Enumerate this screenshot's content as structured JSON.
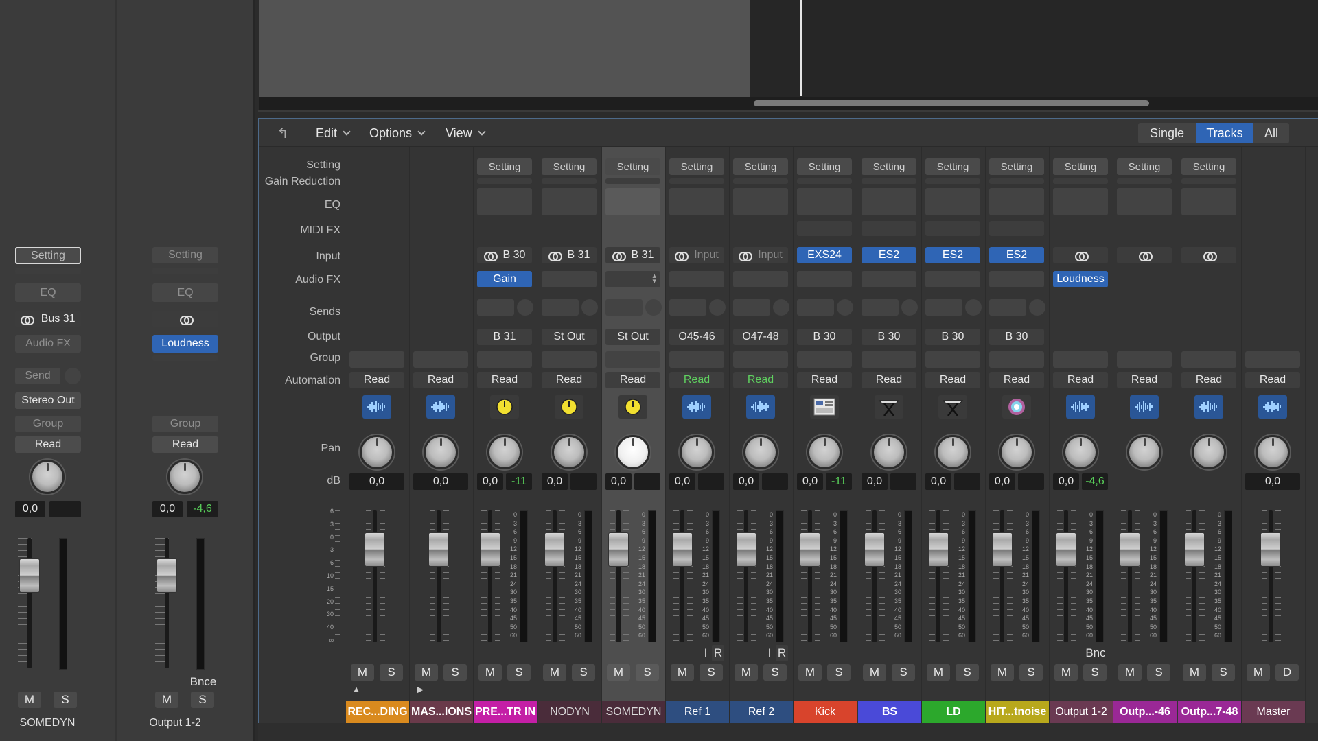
{
  "inspector": {
    "left": {
      "setting": "Setting",
      "eq": "EQ",
      "input_label": "Bus 31",
      "audio_fx": "Audio FX",
      "send": "Send",
      "output": "Stereo Out",
      "group": "Group",
      "automation": "Read",
      "volume": "0,0",
      "peak": "",
      "mute": "M",
      "solo": "S",
      "name": "SOMEDYN"
    },
    "right": {
      "setting": "Setting",
      "eq": "EQ",
      "audio_fx": "Loudness",
      "group": "Group",
      "automation": "Read",
      "volume": "0,0",
      "peak": "-4,6",
      "bounce": "Bnce",
      "mute": "M",
      "solo": "S",
      "name": "Output 1-2"
    }
  },
  "toolbar": {
    "back_icon": "back-arrow-icon",
    "menus": [
      "Edit",
      "Options",
      "View"
    ],
    "view_modes": [
      "Single",
      "Tracks",
      "All"
    ],
    "active_mode": "Tracks"
  },
  "row_labels": {
    "setting": "Setting",
    "gain_reduction": "Gain Reduction",
    "eq": "EQ",
    "midi_fx": "MIDI FX",
    "input": "Input",
    "audio_fx": "Audio FX",
    "sends": "Sends",
    "output": "Output",
    "group": "Group",
    "automation": "Automation",
    "pan": "Pan",
    "db": "dB"
  },
  "fader_scale": [
    "6",
    "3",
    "0",
    "3",
    "6",
    "10",
    "15",
    "20",
    "30",
    "40",
    "∞"
  ],
  "meter_scale": [
    "0",
    "3",
    "6",
    "9",
    "12",
    "15",
    "18",
    "21",
    "24",
    "30",
    "35",
    "40",
    "45",
    "50",
    "60"
  ],
  "channels": [
    {
      "name": "REC...DING",
      "color": "#d98a1e",
      "setting": "",
      "input": "",
      "input_link": false,
      "audio_fx": "",
      "audio_fx_blue": false,
      "output": "",
      "automation": "Read",
      "automation_green": false,
      "icon": "waveform-icon",
      "volume": "0,0",
      "peak": "",
      "mute": "M",
      "solo": "S",
      "ir": false,
      "extra": "▲"
    },
    {
      "name": "MAS...IONS",
      "color": "#6a3a4a",
      "setting": "",
      "input": "",
      "input_link": false,
      "audio_fx": "",
      "audio_fx_blue": false,
      "output": "",
      "automation": "Read",
      "automation_green": false,
      "icon": "waveform-icon",
      "volume": "0,0",
      "peak": "",
      "mute": "M",
      "solo": "S",
      "ir": false,
      "extra": "▶"
    },
    {
      "name": "PRE...TR IN",
      "color": "#c41fa6",
      "setting": "Setting",
      "input": "B 30",
      "input_link": true,
      "audio_fx": "Gain",
      "audio_fx_blue": true,
      "output": "B 31",
      "automation": "Read",
      "automation_green": false,
      "icon": "yellow-dial-icon",
      "volume": "0,0",
      "peak": "-11",
      "mute": "M",
      "solo": "S",
      "ir": false,
      "extra": ""
    },
    {
      "name": "NODYN",
      "color": "#4a2c3a",
      "setting": "Setting",
      "input": "B 31",
      "input_link": true,
      "audio_fx": "",
      "audio_fx_blue": false,
      "output": "St Out",
      "automation": "Read",
      "automation_green": false,
      "icon": "yellow-dial-icon",
      "volume": "0,0",
      "peak": "",
      "mute": "M",
      "solo": "S",
      "ir": false,
      "extra": ""
    },
    {
      "name": "SOMEDYN",
      "color": "#4a2c3a",
      "setting": "Setting",
      "input": "B 31",
      "input_link": true,
      "audio_fx": "",
      "audio_fx_blue": false,
      "output": "St Out",
      "automation": "Read",
      "automation_green": false,
      "icon": "yellow-dial-icon",
      "volume": "0,0",
      "peak": "",
      "mute": "M",
      "solo": "S",
      "ir": false,
      "extra": ""
    },
    {
      "name": "Ref 1",
      "color": "#2e4e80",
      "setting": "Setting",
      "input": "Input",
      "input_link": true,
      "audio_fx": "",
      "audio_fx_blue": false,
      "output": "O45-46",
      "automation": "Read",
      "automation_green": true,
      "icon": "waveform-icon",
      "volume": "0,0",
      "peak": "",
      "mute": "M",
      "solo": "S",
      "ir": true,
      "extra": ""
    },
    {
      "name": "Ref 2",
      "color": "#2e4e80",
      "setting": "Setting",
      "input": "Input",
      "input_link": true,
      "audio_fx": "",
      "audio_fx_blue": false,
      "output": "O47-48",
      "automation": "Read",
      "automation_green": true,
      "icon": "waveform-icon",
      "volume": "0,0",
      "peak": "",
      "mute": "M",
      "solo": "S",
      "ir": true,
      "extra": ""
    },
    {
      "name": "Kick",
      "color": "#d8442c",
      "setting": "Setting",
      "input": "EXS24",
      "input_link": false,
      "audio_fx": "",
      "audio_fx_blue": false,
      "output": "B 30",
      "automation": "Read",
      "automation_green": false,
      "icon": "sampler-icon",
      "volume": "0,0",
      "peak": "-11",
      "mute": "M",
      "solo": "S",
      "ir": false,
      "extra": ""
    },
    {
      "name": "BS",
      "color": "#4a4ad8",
      "setting": "Setting",
      "input": "ES2",
      "input_link": false,
      "audio_fx": "",
      "audio_fx_blue": false,
      "output": "B 30",
      "automation": "Read",
      "automation_green": false,
      "icon": "synth-stand-icon",
      "volume": "0,0",
      "peak": "",
      "mute": "M",
      "solo": "S",
      "ir": false,
      "extra": ""
    },
    {
      "name": "LD",
      "color": "#2ca82c",
      "setting": "Setting",
      "input": "ES2",
      "input_link": false,
      "audio_fx": "",
      "audio_fx_blue": false,
      "output": "B 30",
      "automation": "Read",
      "automation_green": false,
      "icon": "synth-stand-icon",
      "volume": "0,0",
      "peak": "",
      "mute": "M",
      "solo": "S",
      "ir": false,
      "extra": ""
    },
    {
      "name": "HIT...tnoise",
      "color": "#b8a81c",
      "setting": "Setting",
      "input": "ES2",
      "input_link": false,
      "audio_fx": "",
      "audio_fx_blue": false,
      "output": "B 30",
      "automation": "Read",
      "automation_green": false,
      "icon": "burst-icon",
      "volume": "0,0",
      "peak": "",
      "mute": "M",
      "solo": "S",
      "ir": false,
      "extra": ""
    },
    {
      "name": "Output 1-2",
      "color": "#6a3a52",
      "setting": "Setting",
      "input": "",
      "input_link": true,
      "audio_fx": "Loudness",
      "audio_fx_blue": true,
      "output": "",
      "automation": "Read",
      "automation_green": false,
      "icon": "waveform-icon",
      "volume": "0,0",
      "peak": "-4,6",
      "mute": "M",
      "solo": "S",
      "ir": false,
      "extra": "Bnc"
    },
    {
      "name": "Outp...-46",
      "color": "#9a2896",
      "setting": "Setting",
      "input": "",
      "input_link": true,
      "audio_fx": "",
      "audio_fx_blue": false,
      "output": "",
      "automation": "Read",
      "automation_green": false,
      "icon": "waveform-icon",
      "volume": "",
      "peak": "",
      "mute": "M",
      "solo": "S",
      "ir": false,
      "extra": ""
    },
    {
      "name": "Outp...7-48",
      "color": "#9a2896",
      "setting": "Setting",
      "input": "",
      "input_link": true,
      "audio_fx": "",
      "audio_fx_blue": false,
      "output": "",
      "automation": "Read",
      "automation_green": false,
      "icon": "waveform-icon",
      "volume": "",
      "peak": "",
      "mute": "M",
      "solo": "S",
      "ir": false,
      "extra": ""
    },
    {
      "name": "Master",
      "color": "#6a3a52",
      "setting": "",
      "input": "",
      "input_link": false,
      "audio_fx": "",
      "audio_fx_blue": false,
      "output": "",
      "automation": "Read",
      "automation_green": false,
      "icon": "waveform-icon",
      "volume": "0,0",
      "peak": "",
      "mute": "M",
      "solo": "D",
      "ir": false,
      "extra": ""
    }
  ],
  "ir_labels": {
    "i": "I",
    "r": "R"
  }
}
